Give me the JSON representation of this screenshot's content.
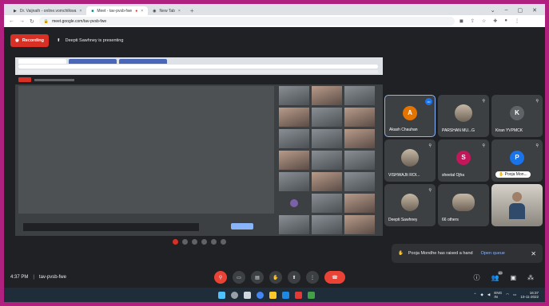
{
  "browser": {
    "tabs": [
      {
        "label": "Dr. Vaijnath - online.vomchilkwa",
        "active": false
      },
      {
        "label": "Meet - tav-pvsb-fwe",
        "active": true
      },
      {
        "label": "New Tab",
        "active": false
      }
    ],
    "new_tab_label": "+",
    "url": "meet.google.com/tav-pvsb-fwe"
  },
  "meet": {
    "recording_label": "Recording",
    "presenting_label": "Deepti Sawhney is presenting",
    "time": "4:37 PM",
    "meeting_code": "tav-pvsb-fwe",
    "participant_count": "69"
  },
  "participants": [
    {
      "name": "Akash Chauhan",
      "initial": "A",
      "avatar_color": "#e37400",
      "kind": "avatar",
      "focused": true
    },
    {
      "name": "PARSHAN MU...G",
      "initial": "",
      "kind": "photo"
    },
    {
      "name": "Kiran YVPMCK",
      "initial": "K",
      "avatar_color": "#5f6368",
      "kind": "avatar"
    },
    {
      "name": "VISHWAJIt ROI...",
      "initial": "",
      "kind": "photo"
    },
    {
      "name": "sheetal Ojha",
      "initial": "S",
      "avatar_color": "#c2185b",
      "kind": "avatar"
    },
    {
      "name": "Pooja Mon...",
      "initial": "P",
      "avatar_color": "#1a73e8",
      "kind": "avatar",
      "pill": true
    },
    {
      "name": "Deepti Sawhney",
      "initial": "",
      "kind": "photo"
    },
    {
      "name": "66 others",
      "initial": "",
      "kind": "group"
    },
    {
      "name": "",
      "initial": "",
      "kind": "camera"
    }
  ],
  "notification": {
    "text": "Pooja Mondhe has raised a hand",
    "action": "Open queue"
  },
  "taskbar": {
    "lang": "ENG\nIN",
    "time": "16:37",
    "date": "10-11-2022"
  }
}
